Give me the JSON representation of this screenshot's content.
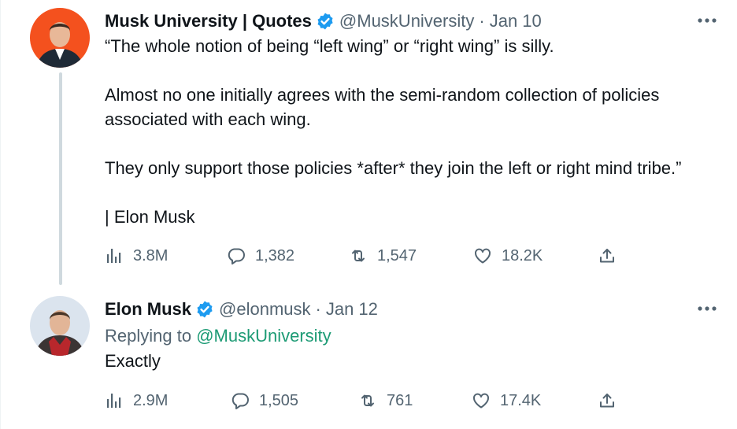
{
  "tweets": [
    {
      "display_name": "Musk University | Quotes",
      "handle": "@MuskUniversity",
      "separator": "·",
      "date": "Jan 10",
      "text": "“The whole notion of being “left wing” or “right wing” is silly.\n\nAlmost no one initially agrees with the semi-random collection of policies associated with each wing.\n\nThey only support those policies *after* they join the left or right mind tribe.”\n\n| Elon Musk",
      "stats": {
        "views": "3.8M",
        "replies": "1,382",
        "retweets": "1,547",
        "likes": "18.2K"
      },
      "icons": {
        "verified": "verified-badge-icon",
        "more": "more-options-icon",
        "views": "views-chart-icon",
        "reply": "reply-bubble-icon",
        "retweet": "retweet-icon",
        "like": "heart-icon",
        "share": "share-icon"
      },
      "avatar_bg": "#f4511e"
    },
    {
      "display_name": "Elon Musk",
      "handle": "@elonmusk",
      "separator": "·",
      "date": "Jan 12",
      "replying_label": "Replying to",
      "replying_to": "@MuskUniversity",
      "text": "Exactly",
      "stats": {
        "views": "2.9M",
        "replies": "1,505",
        "retweets": "761",
        "likes": "17.4K"
      },
      "avatar_bg": "#dbe4ee"
    }
  ],
  "colors": {
    "text": "#0f1419",
    "secondary": "#536471",
    "verified": "#1d9bf0",
    "mention": "#1d9b75",
    "thread_line": "#cfd9de"
  }
}
